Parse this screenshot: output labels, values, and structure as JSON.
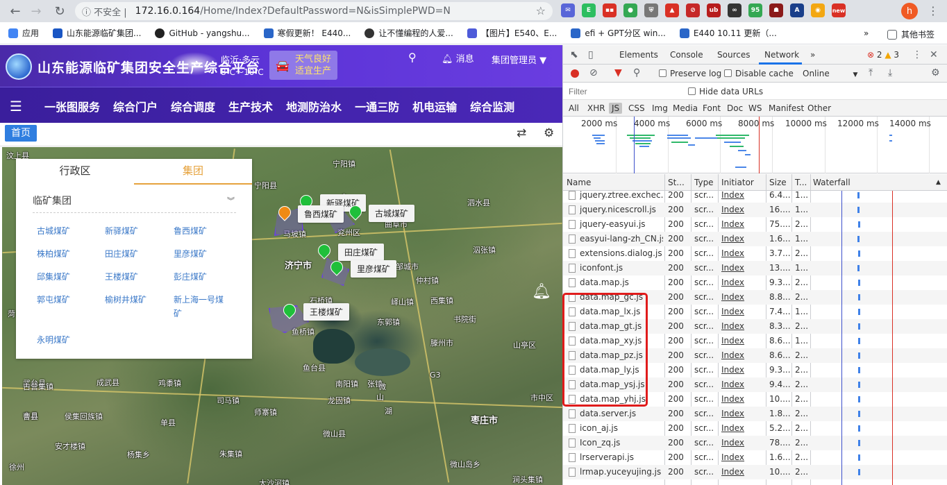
{
  "browser": {
    "url_warning": "不安全",
    "url_host": "172.16.0.164",
    "url_path": "/Home/Index?DefaultPassword=N&isSimplePWD=N",
    "avatar_letter": "h",
    "ext_badges": [
      "95",
      "new"
    ],
    "bookmarks": [
      {
        "label": "应用",
        "color": "#4285f4"
      },
      {
        "label": "山东能源临矿集团...",
        "color": "#1a56c4"
      },
      {
        "label": "GitHub - yangshu...",
        "color": "#222222"
      },
      {
        "label": "寒假更新！ E440...",
        "color": "#2a66c8"
      },
      {
        "label": "让不懂编程的人爱...",
        "color": "#333333"
      },
      {
        "label": "【图片】E540、E...",
        "color": "#4e5bd9"
      },
      {
        "label": "efi + GPT分区 win...",
        "color": "#2a66c8"
      },
      {
        "label": "E440 10.11 更新（...",
        "color": "#2a66c8"
      }
    ],
    "bookmarks_more": "»",
    "bookmarks_other": "其他书签"
  },
  "app": {
    "title": "山东能源临矿集团安全生产综合平台",
    "weather_location": "临沂·多云",
    "weather_temp": "8℃～10℃",
    "weather_line1": "天气良好",
    "weather_line2": "适宜生产",
    "message_label": "消息",
    "user_label": "集团管理员",
    "nav": [
      "一张图服务",
      "综合门户",
      "综合调度",
      "生产技术",
      "地测防治水",
      "一通三防",
      "机电运输",
      "综合监测"
    ],
    "home_tab": "首页",
    "panel": {
      "tab_admin": "行政区",
      "tab_group": "集团",
      "select_value": "临矿集团",
      "mines": [
        "古城煤矿",
        "新驿煤矿",
        "鲁西煤矿",
        "株柏煤矿",
        "田庄煤矿",
        "里彦煤矿",
        "邱集煤矿",
        "王楼煤矿",
        "彭庄煤矿",
        "郭屯煤矿",
        "榆树井煤矿",
        "新上海一号煤矿",
        "永明煤矿"
      ]
    },
    "map": {
      "pins": [
        "新驿煤矿",
        "鲁西煤矿",
        "古城煤矿",
        "田庄煤矿",
        "里彦煤矿",
        "王楼煤矿"
      ],
      "places": [
        {
          "t": "汶上县"
        },
        {
          "t": "宁阳县"
        },
        {
          "t": "宁阳镇"
        },
        {
          "t": "乡"
        },
        {
          "t": "泗水县"
        },
        {
          "t": "曲阜市"
        },
        {
          "t": "兖州区"
        },
        {
          "t": "济宁市",
          "big": true
        },
        {
          "t": "邹城市"
        },
        {
          "t": "泅张镇"
        },
        {
          "t": "石桥镇"
        },
        {
          "t": "峄山镇"
        },
        {
          "t": "鱼台县"
        },
        {
          "t": "滕州市"
        },
        {
          "t": "山亭区"
        },
        {
          "t": "武台县"
        },
        {
          "t": "成武县"
        },
        {
          "t": "单县"
        },
        {
          "t": "鸡黍镇"
        },
        {
          "t": "司马镇"
        },
        {
          "t": "师寨镇"
        },
        {
          "t": "龙固镇"
        },
        {
          "t": "微山县"
        },
        {
          "t": "枣庄市",
          "big": true
        },
        {
          "t": "丰县"
        },
        {
          "t": "徐州"
        },
        {
          "t": "朱集镇"
        },
        {
          "t": "大沙河镇"
        },
        {
          "t": "涧头集镇"
        },
        {
          "t": "微山岛乡"
        },
        {
          "t": "市中区"
        },
        {
          "t": "古营集镇"
        },
        {
          "t": "侯集回族镇"
        },
        {
          "t": "曹县"
        },
        {
          "t": "安才楼镇"
        },
        {
          "t": "杨集乡"
        },
        {
          "t": "菏"
        },
        {
          "t": "鱼桥镇"
        },
        {
          "t": "西集镇"
        },
        {
          "t": "仲村镇"
        },
        {
          "t": "马坡镇"
        },
        {
          "t": "东郭镇"
        },
        {
          "t": "张镇"
        },
        {
          "t": "书院街"
        },
        {
          "t": "南阳镇"
        },
        {
          "t": "G3"
        },
        {
          "t": "微"
        },
        {
          "t": "山"
        },
        {
          "t": "湖"
        }
      ]
    }
  },
  "devtools": {
    "tabs": [
      "Elements",
      "Console",
      "Sources",
      "Network"
    ],
    "more": "»",
    "errors": "2",
    "warnings": "3",
    "preserve_log": "Preserve log",
    "disable_cache": "Disable cache",
    "throttle": "Online",
    "filter_placeholder": "Filter",
    "hide_data_urls": "Hide data URLs",
    "types": [
      "All",
      "XHR",
      "JS",
      "CSS",
      "Img",
      "Media",
      "Font",
      "Doc",
      "WS",
      "Manifest",
      "Other"
    ],
    "timeline_labels": [
      "2000 ms",
      "4000 ms",
      "6000 ms",
      "8000 ms",
      "10000 ms",
      "12000 ms",
      "14000 ms"
    ],
    "columns": [
      "Name",
      "St...",
      "Type",
      "Initiator",
      "Size",
      "T...",
      "Waterfall"
    ],
    "rows": [
      {
        "name": "jquery.ztree.exchec...",
        "status": "200",
        "type": "scr...",
        "init": "Index",
        "size": "6.4...",
        "time": "1..."
      },
      {
        "name": "jquery.nicescroll.js",
        "status": "200",
        "type": "scr...",
        "init": "Index",
        "size": "16....",
        "time": "1..."
      },
      {
        "name": "jquery-easyui.js",
        "status": "200",
        "type": "scr...",
        "init": "Index",
        "size": "75....",
        "time": "2..."
      },
      {
        "name": "easyui-lang-zh_CN.js",
        "status": "200",
        "type": "scr...",
        "init": "Index",
        "size": "1.6...",
        "time": "1..."
      },
      {
        "name": "extensions.dialog.js",
        "status": "200",
        "type": "scr...",
        "init": "Index",
        "size": "3.7...",
        "time": "2..."
      },
      {
        "name": "iconfont.js",
        "status": "200",
        "type": "scr...",
        "init": "Index",
        "size": "13....",
        "time": "1..."
      },
      {
        "name": "data.map.js",
        "status": "200",
        "type": "scr...",
        "init": "Index",
        "size": "9.3...",
        "time": "2..."
      },
      {
        "name": "data.map_gc.js",
        "status": "200",
        "type": "scr...",
        "init": "Index",
        "size": "8.8...",
        "time": "2..."
      },
      {
        "name": "data.map_lx.js",
        "status": "200",
        "type": "scr...",
        "init": "Index",
        "size": "7.4...",
        "time": "1..."
      },
      {
        "name": "data.map_gt.js",
        "status": "200",
        "type": "scr...",
        "init": "Index",
        "size": "8.3...",
        "time": "2..."
      },
      {
        "name": "data.map_xy.js",
        "status": "200",
        "type": "scr...",
        "init": "Index",
        "size": "8.6...",
        "time": "1..."
      },
      {
        "name": "data.map_pz.js",
        "status": "200",
        "type": "scr...",
        "init": "Index",
        "size": "8.6...",
        "time": "2..."
      },
      {
        "name": "data.map_ly.js",
        "status": "200",
        "type": "scr...",
        "init": "Index",
        "size": "9.3...",
        "time": "2..."
      },
      {
        "name": "data.map_ysj.js",
        "status": "200",
        "type": "scr...",
        "init": "Index",
        "size": "9.4...",
        "time": "2..."
      },
      {
        "name": "data.map_yhj.js",
        "status": "200",
        "type": "scr...",
        "init": "Index",
        "size": "10....",
        "time": "2..."
      },
      {
        "name": "data.server.js",
        "status": "200",
        "type": "scr...",
        "init": "Index",
        "size": "1.8...",
        "time": "2..."
      },
      {
        "name": "icon_aj.js",
        "status": "200",
        "type": "scr...",
        "init": "Index",
        "size": "5.2...",
        "time": "2..."
      },
      {
        "name": "Icon_zq.js",
        "status": "200",
        "type": "scr...",
        "init": "Index",
        "size": "78....",
        "time": "2..."
      },
      {
        "name": "lrserverapi.js",
        "status": "200",
        "type": "scr...",
        "init": "Index",
        "size": "1.6...",
        "time": "2..."
      },
      {
        "name": "lrmap.yuceyujing.js",
        "status": "200",
        "type": "scr...",
        "init": "Index",
        "size": "10....",
        "time": "2..."
      }
    ]
  }
}
